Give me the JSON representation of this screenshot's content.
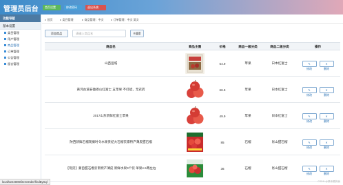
{
  "header": {
    "brand": "管理员后台",
    "buttons": [
      "首页设置",
      "修改密码",
      "退出系统"
    ]
  },
  "sidebar": {
    "title": "功能导航",
    "section": "基本设置",
    "items": [
      {
        "label": "类目管理",
        "color": "#3a8dd8"
      },
      {
        "label": "用户管理",
        "color": "#3a8dd8"
      },
      {
        "label": "商品管理",
        "color": "#3a8dd8",
        "active": true
      },
      {
        "label": "订单管理",
        "color": "#3a8dd8"
      },
      {
        "label": "公告管理",
        "color": "#3a8dd8"
      },
      {
        "label": "留言管理",
        "color": "#3a8dd8"
      }
    ]
  },
  "breadcrumbs": [
    "首页",
    "类目管理",
    "商品管理：中文",
    "订单管理：中文 英文"
  ],
  "toolbar": {
    "add_label": "添加商品",
    "search_placeholder": "请输入商品名",
    "search_label": "搜索"
  },
  "table": {
    "headers": [
      "商品名",
      "商品主图",
      "价格",
      "商品一级分类",
      "商品二级分类",
      "操作"
    ],
    "rows": [
      {
        "name": "山西运城",
        "image": "apple-box",
        "price": "54.9",
        "cat1": "苹果",
        "cat2": "日本红富士"
      },
      {
        "name": "黄河古道安徽砀山红富士 五苹果 不打蜡，无农药",
        "image": "apple-red",
        "price": "66.5",
        "cat1": "苹果",
        "cat2": "日本红富士"
      },
      {
        "name": "2017山东新鲜红富士苹果",
        "image": "apple-red",
        "price": "49.9",
        "cat1": "苹果",
        "cat2": "日本红富士"
      },
      {
        "name": "陕西新鲜石榴现摘时令水果贵妃大石榴农家特产薄皮甜石榴",
        "image": "pomegranate-box",
        "price": "85",
        "cat1": "石榴",
        "cat2": "肖山甜石榴"
      },
      {
        "name": "【现货】蒙自甜石榴云南特产薄皮 新鲜水果9个装 单果4.5两左右",
        "image": "pomegranate-box-2",
        "price": "36",
        "cat1": "石榴",
        "cat2": "肖山甜石榴"
      }
    ],
    "edit_label": "修改",
    "delete_label": "删除"
  },
  "statusbar": "localhost:8080/itemOrder/findBySql",
  "watermark": "CSDN @原来看的我"
}
